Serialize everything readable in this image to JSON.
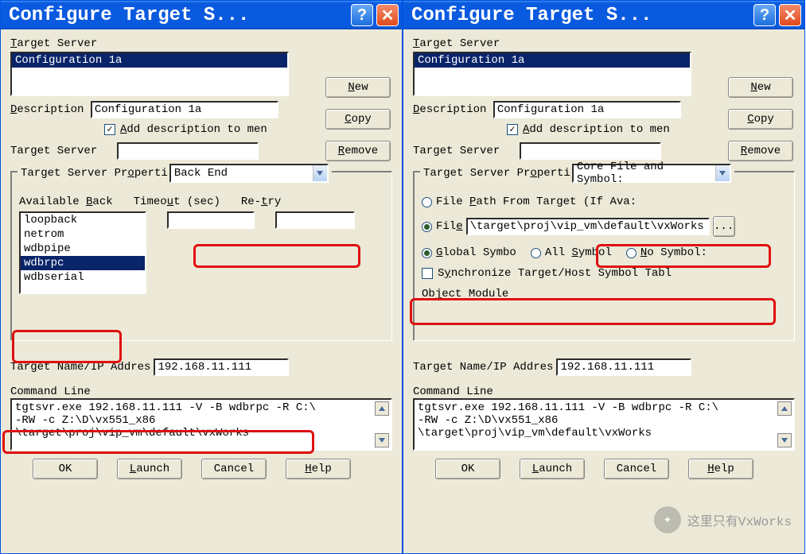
{
  "window_title": "Configure Target S...",
  "labels": {
    "target_server": "Target Server",
    "description": "Description",
    "add_desc": "Add description to men",
    "target_server2": "Target Server",
    "tsp_legend": "Target Server Properti",
    "available_back": "Available Back",
    "timeout": "Timeout (sec)",
    "retry": "Re-try",
    "target_name_ip": "Target Name/IP Addres",
    "command_line": "Command Line",
    "file_path_from_target": "File Path From Target (If Ava:",
    "file": "File",
    "global_symbol": "Global Symbo",
    "all_symbol": "All Symbol",
    "no_symbol": "No Symbol:",
    "sync": "Synchronize Target/Host Symbol Tabl",
    "object_module": "Object Module"
  },
  "buttons": {
    "new": "New",
    "copy": "Copy",
    "remove": "Remove",
    "ok": "OK",
    "launch": "Launch",
    "cancel": "Cancel",
    "help": "Help",
    "browse": "..."
  },
  "values": {
    "config_list_item": "Configuration 1a",
    "description_value": "Configuration 1a",
    "combo_left": "Back End",
    "combo_right": "Core File and Symbol:",
    "backends": [
      "loopback",
      "netrom",
      "wdbpipe",
      "wdbrpc",
      "wdbserial"
    ],
    "backend_selected": "wdbrpc",
    "ip": "192.168.11.111",
    "file_path": "\\target\\proj\\vip_vm\\default\\vxWorks",
    "cmdline": "tgtsvr.exe 192.168.11.111 -V -B wdbrpc -R C:\\\n-RW -c Z:\\D\\vx551_x86\n\\target\\proj\\vip_vm\\default\\vxWorks"
  },
  "watermark": "这里只有VxWorks"
}
